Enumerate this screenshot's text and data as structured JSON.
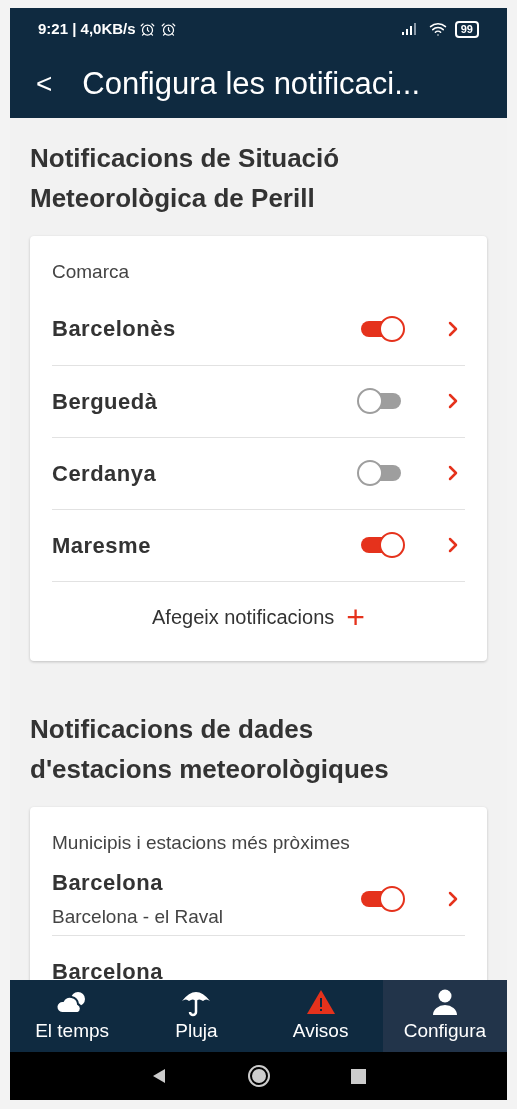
{
  "status_bar": {
    "time": "9:21 | 4,0KB/s",
    "battery": "99"
  },
  "header": {
    "back": "<",
    "title": "Configura les notificaci..."
  },
  "sections": [
    {
      "title": "Notificacions de Situació Meteorològica de Perill",
      "card_label": "Comarca",
      "rows": [
        {
          "name": "Barcelonès",
          "on": true
        },
        {
          "name": "Berguedà",
          "on": false
        },
        {
          "name": "Cerdanya",
          "on": false
        },
        {
          "name": "Maresme",
          "on": true
        }
      ],
      "add_label": "Afegeix notificacions",
      "add_icon": "+"
    },
    {
      "title": "Notificacions de dades d'estacions meteorològiques",
      "card_label": "Municipis i estacions més pròximes",
      "rows": [
        {
          "name": "Barcelona",
          "subtitle": "Barcelona - el Raval",
          "on": true
        },
        {
          "name": "Barcelona"
        }
      ]
    }
  ],
  "bottom_nav": [
    {
      "label": "El temps",
      "selected": false
    },
    {
      "label": "Pluja",
      "selected": false
    },
    {
      "label": "Avisos",
      "selected": false
    },
    {
      "label": "Configura",
      "selected": true
    }
  ]
}
